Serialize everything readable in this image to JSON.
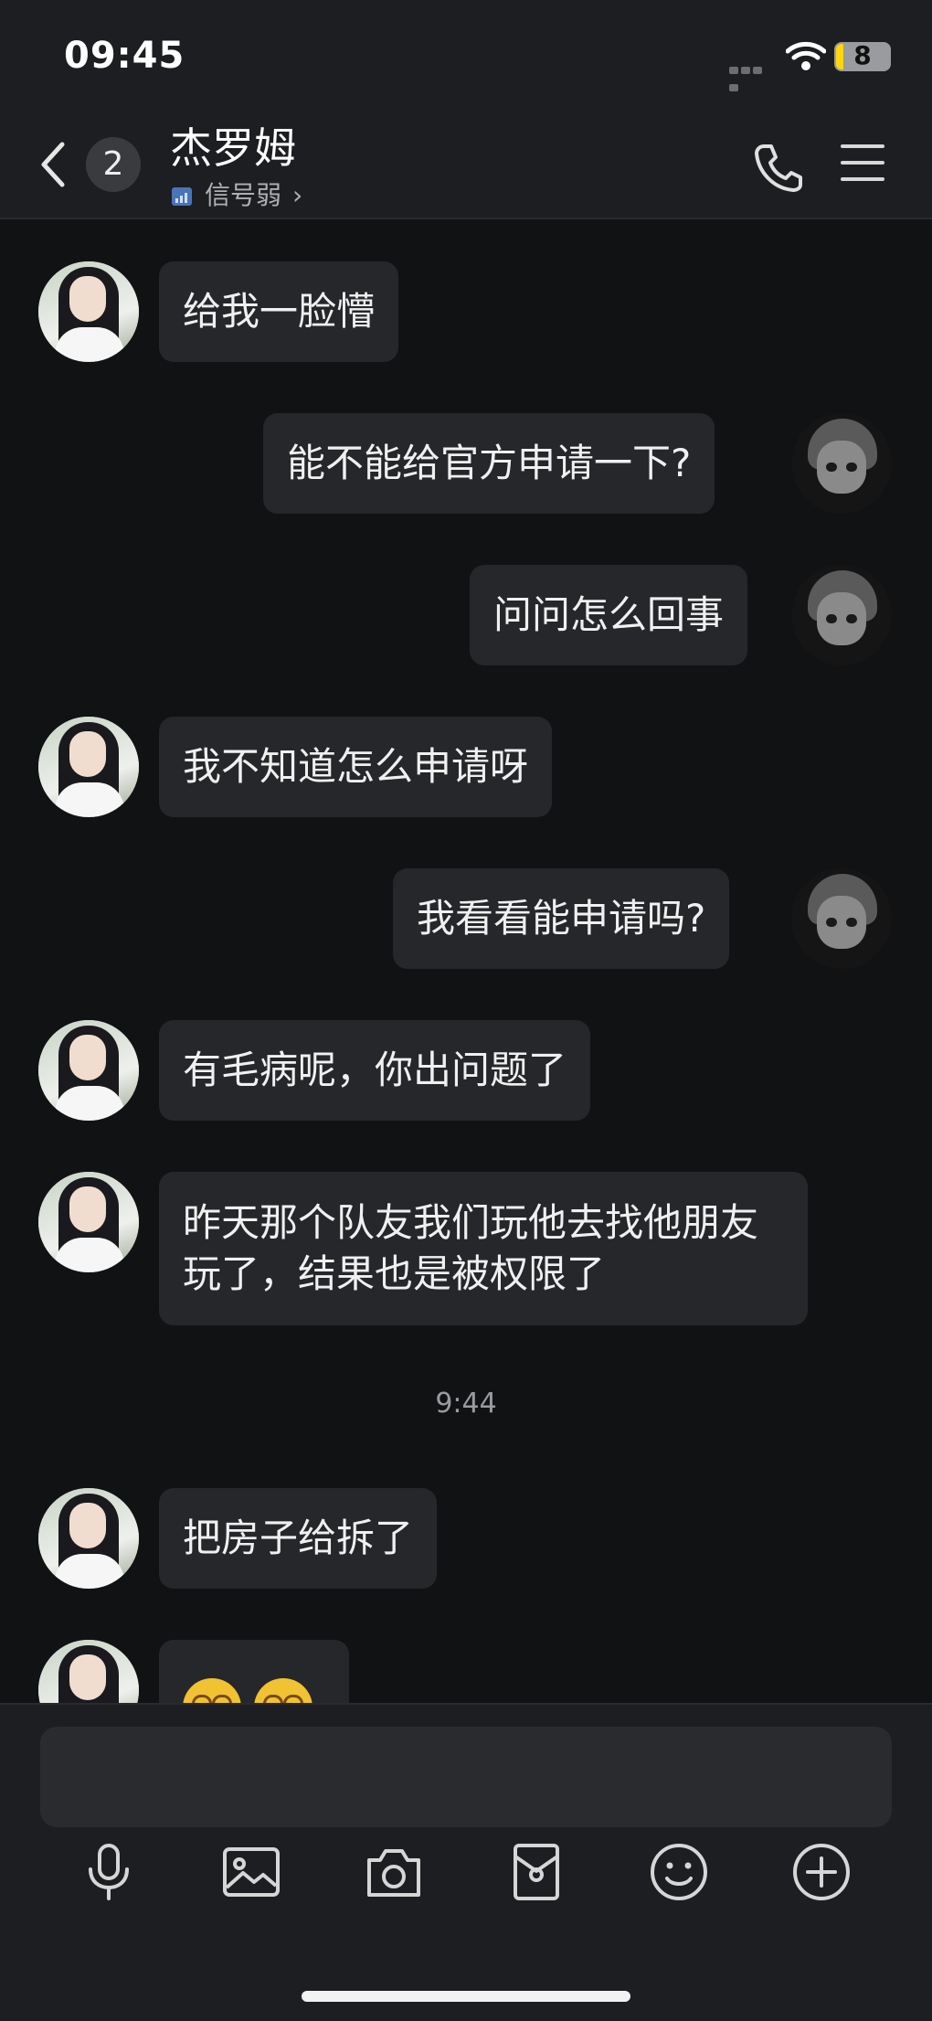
{
  "status_bar": {
    "time": "09:45",
    "battery": "8"
  },
  "header": {
    "back_badge": "2",
    "title": "杰罗姆",
    "subtitle": "信号弱"
  },
  "messages": [
    {
      "side": "left",
      "text": "给我一脸懵"
    },
    {
      "side": "right",
      "text": "能不能给官方申请一下?"
    },
    {
      "side": "right",
      "text": "问问怎么回事"
    },
    {
      "side": "left",
      "text": "我不知道怎么申请呀"
    },
    {
      "side": "right",
      "text": "我看看能申请吗?"
    },
    {
      "side": "left",
      "text": "有毛病呢，你出问题了"
    },
    {
      "side": "left",
      "text": "昨天那个队友我们玩他去找他朋友玩了，结果也是被权限了"
    },
    {
      "side": "left",
      "text": "把房子给拆了"
    }
  ],
  "timestamp": "9:44",
  "composer": {
    "placeholder": ""
  },
  "toolbar_icons": [
    "microphone-icon",
    "image-icon",
    "camera-icon",
    "red-packet-icon",
    "emoji-icon",
    "plus-icon"
  ]
}
